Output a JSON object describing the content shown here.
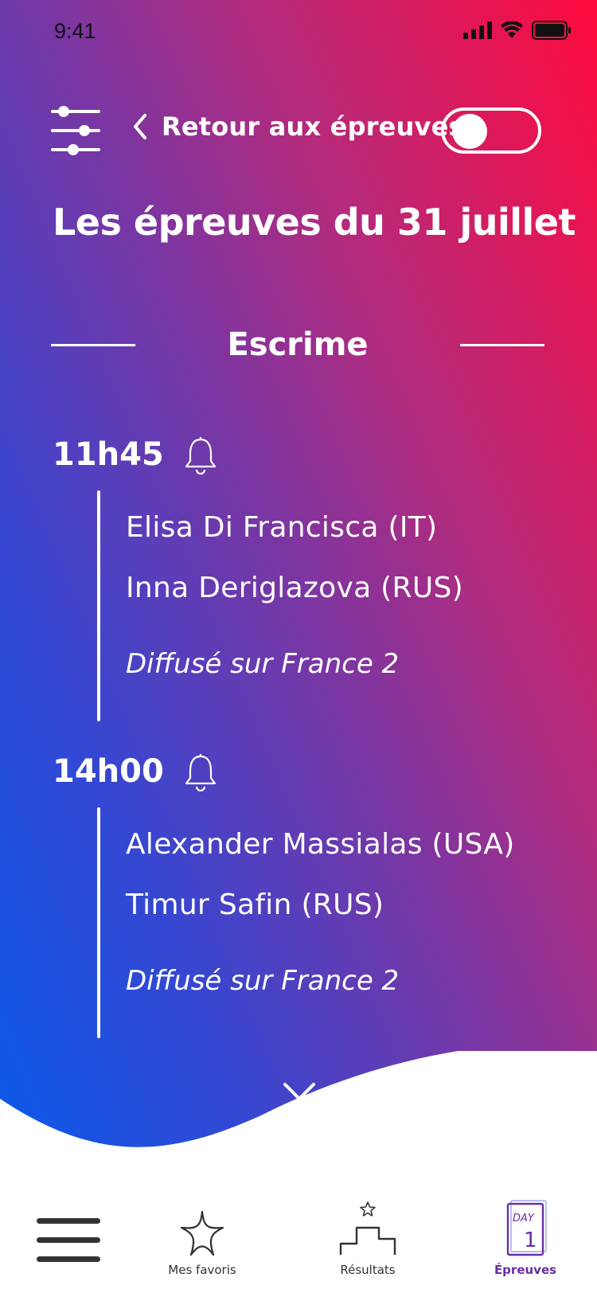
{
  "status_bar": {
    "time": "9:41"
  },
  "header": {
    "back_label": "Retour aux épreuves"
  },
  "page_title": "Les épreuves du 31 juillet",
  "section": {
    "title": "Escrime"
  },
  "events": [
    {
      "time": "11h45",
      "competitors": [
        "Elisa Di Francisca (IT)",
        "Inna Deriglazova  (RUS)"
      ],
      "broadcast": "Diffusé sur France 2"
    },
    {
      "time": "14h00",
      "competitors": [
        "Alexander Massialas (USA)",
        "Timur Safin (RUS)"
      ],
      "broadcast": "Diffusé sur France 2"
    }
  ],
  "tabbar": {
    "tabs": [
      {
        "label": "Mes favoris",
        "icon": "star-icon"
      },
      {
        "label": "Résultats",
        "icon": "podium-icon"
      },
      {
        "label": "Épreuves",
        "icon": "calendar-day-icon",
        "active": true
      }
    ]
  },
  "colors": {
    "gradient_red": "#ff0a3c",
    "gradient_purple": "#7a36a3",
    "gradient_blue": "#015ef0",
    "active_tab": "#6b2fa3"
  }
}
